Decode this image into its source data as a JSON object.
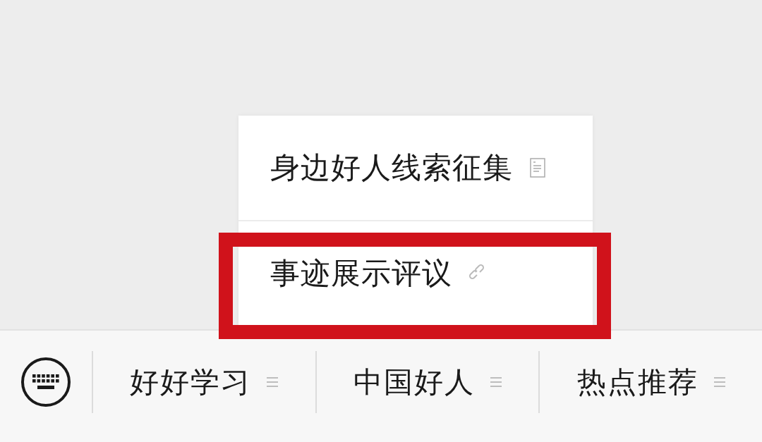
{
  "popup_menu": {
    "items": [
      {
        "label": "身边好人线索征集",
        "kind": "page",
        "highlighted": false
      },
      {
        "label": "事迹展示评议",
        "kind": "link",
        "highlighted": true
      }
    ]
  },
  "menu_bar": {
    "items": [
      {
        "label": "好好学习",
        "has_submenu": true
      },
      {
        "label": "中国好人",
        "has_submenu": true
      },
      {
        "label": "热点推荐",
        "has_submenu": true
      }
    ]
  }
}
